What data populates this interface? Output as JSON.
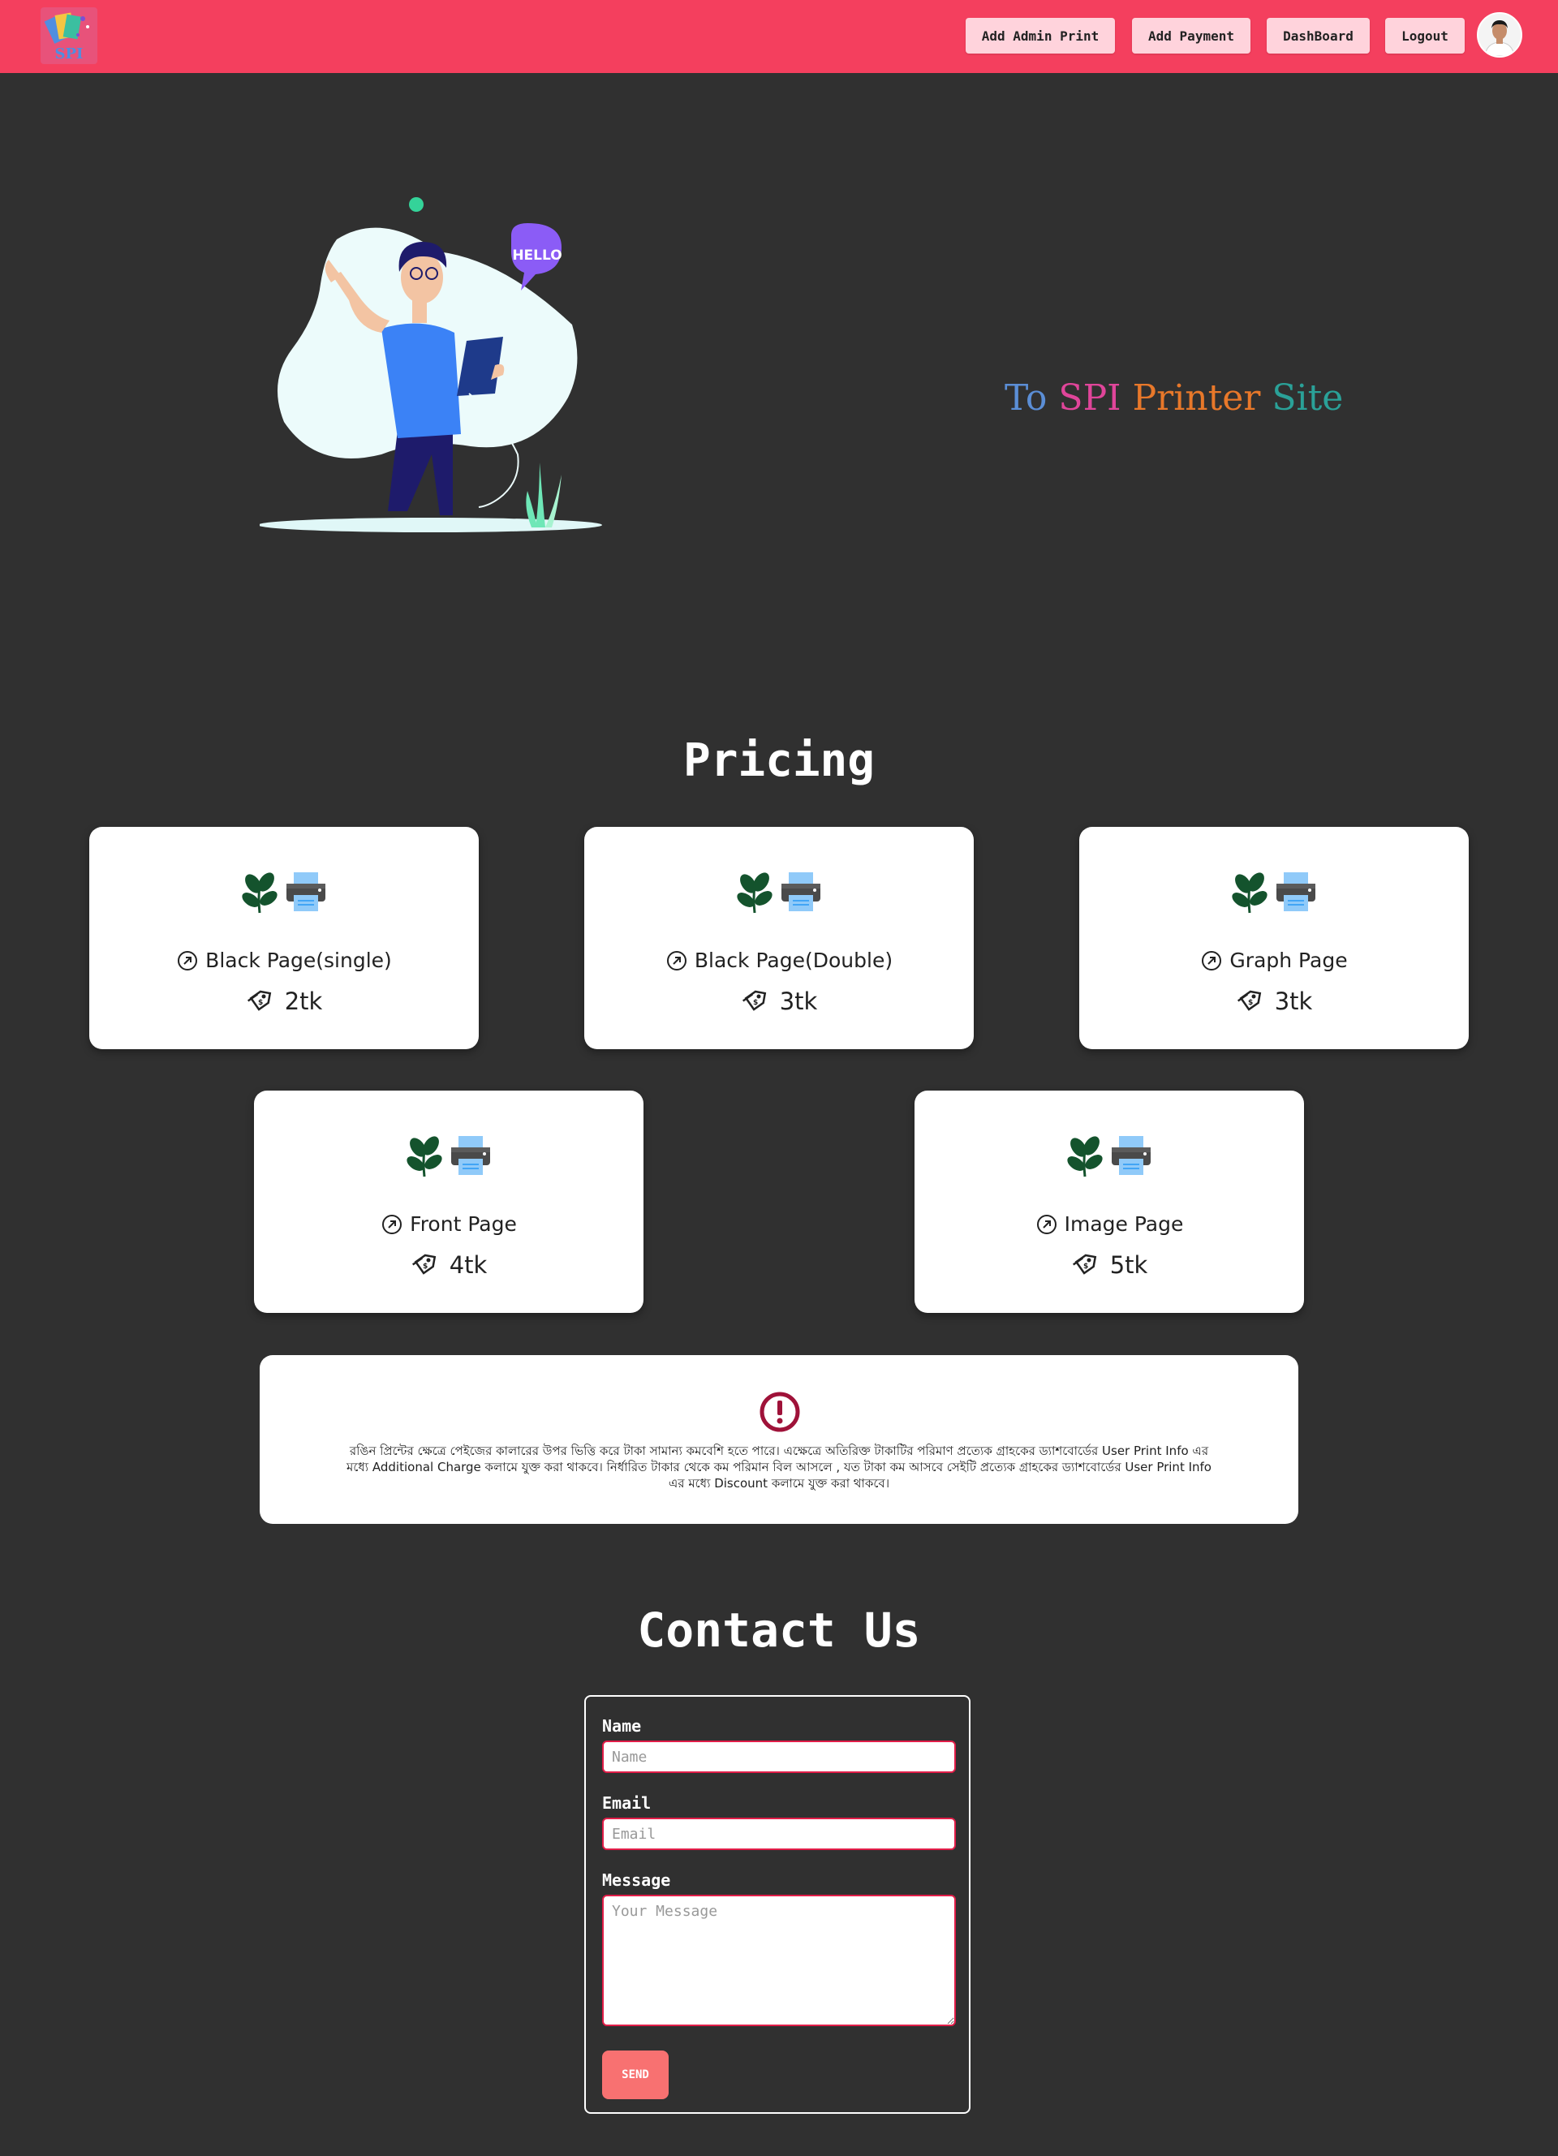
{
  "navbar": {
    "logo_text": "SPI",
    "buttons": [
      "Add Admin Print",
      "Add Payment",
      "DashBoard",
      "Logout"
    ]
  },
  "hero": {
    "bubble_text": "HELLO",
    "title_words": [
      {
        "text": "To",
        "color": "#5b8ed6"
      },
      {
        "text": "SPI",
        "color": "#e0459a"
      },
      {
        "text": "Printer",
        "color": "#e8782a"
      },
      {
        "text": "Site",
        "color": "#2aa198"
      }
    ]
  },
  "pricing": {
    "title": "Pricing",
    "cards": [
      {
        "name": "Black Page(single)",
        "price": "2tk"
      },
      {
        "name": "Black Page(Double)",
        "price": "3tk"
      },
      {
        "name": "Graph Page",
        "price": "3tk"
      },
      {
        "name": "Front Page",
        "price": "4tk"
      },
      {
        "name": "Image Page",
        "price": "5tk"
      }
    ],
    "note": "রঙিন প্রিন্টের ক্ষেত্রে পেইজের কালারের উপর ভিত্তি করে টাকা সামান্য কমবেশি হতে পারে। এক্ষেত্রে অতিরিক্ত টাকাটির পরিমাণ প্রত্যেক গ্রাহকের ড্যাশবোর্ডের User Print Info এর মধ্যে Additional Charge কলামে যুক্ত করা থাকবে। নির্ধারিত টাকার থেকে কম পরিমান বিল আসলে , যত টাকা কম আসবে সেইটি প্রত্যেক গ্রাহকের ড্যাশবোর্ডের User Print Info এর মধ্যে Discount কলামে যুক্ত করা থাকবে।"
  },
  "contact": {
    "title": "Contact Us",
    "name_label": "Name",
    "name_placeholder": "Name",
    "email_label": "Email",
    "email_placeholder": "Email",
    "message_label": "Message",
    "message_placeholder": "Your Message",
    "send_label": "SEND"
  },
  "colors": {
    "navbar": "#f43f5e",
    "background": "#303030",
    "nav_button": "#ffd3dc",
    "input_border": "#e11d48",
    "send_button": "#f87171",
    "alert_icon": "#9f1239"
  }
}
